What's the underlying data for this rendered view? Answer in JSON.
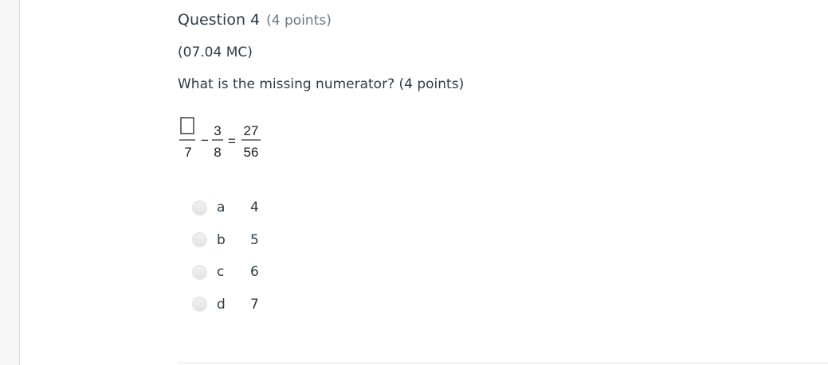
{
  "question": {
    "title": "Question 4",
    "points_label": "(4 points)",
    "code": "(07.04 MC)",
    "prompt": "What is the missing numerator? (4 points)"
  },
  "equation": {
    "term1_denominator": "7",
    "operator": "−",
    "term2_numerator": "3",
    "term2_denominator": "8",
    "equals": "=",
    "result_numerator": "27",
    "result_denominator": "56"
  },
  "answers": [
    {
      "letter": "a",
      "value": "4"
    },
    {
      "letter": "b",
      "value": "5"
    },
    {
      "letter": "c",
      "value": "6"
    },
    {
      "letter": "d",
      "value": "7"
    }
  ]
}
